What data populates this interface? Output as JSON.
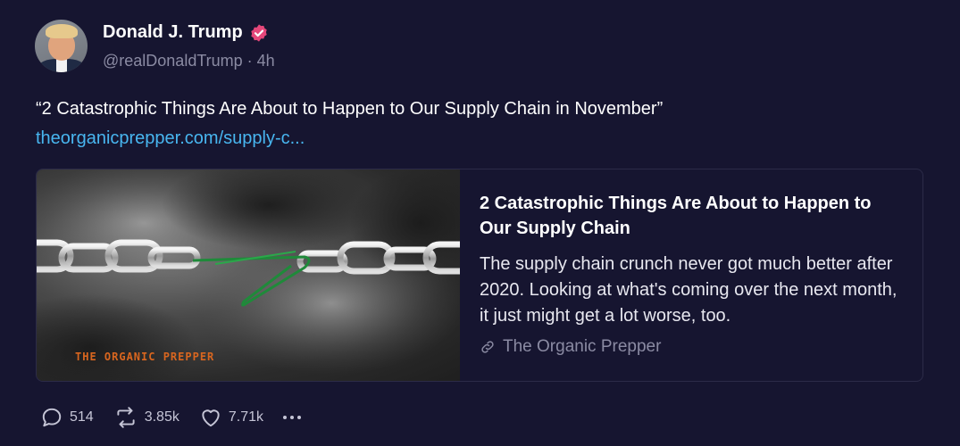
{
  "author": {
    "display_name": "Donald J. Trump",
    "handle": "@realDonaldTrump · 4h",
    "verified_color": "#e5477a"
  },
  "post": {
    "text": "“2 Catastrophic Things Are About to Happen to Our Supply Chain in November”",
    "link_text": "theorganicprepper.com/supply-c..."
  },
  "card": {
    "title": "2 Catastrophic Things Are About to Happen to Our Supply Chain",
    "description": "The supply chain crunch never got much better after 2020. Looking at what's coming over the next month, it just might get a lot worse, too.",
    "source": "The Organic Prepper",
    "image_watermark": "THE ORGANIC PREPPER"
  },
  "actions": {
    "replies": "514",
    "reposts": "3.85k",
    "likes": "7.71k"
  },
  "colors": {
    "background": "#161530",
    "link": "#48b6f0",
    "muted": "#8b8ba3"
  }
}
